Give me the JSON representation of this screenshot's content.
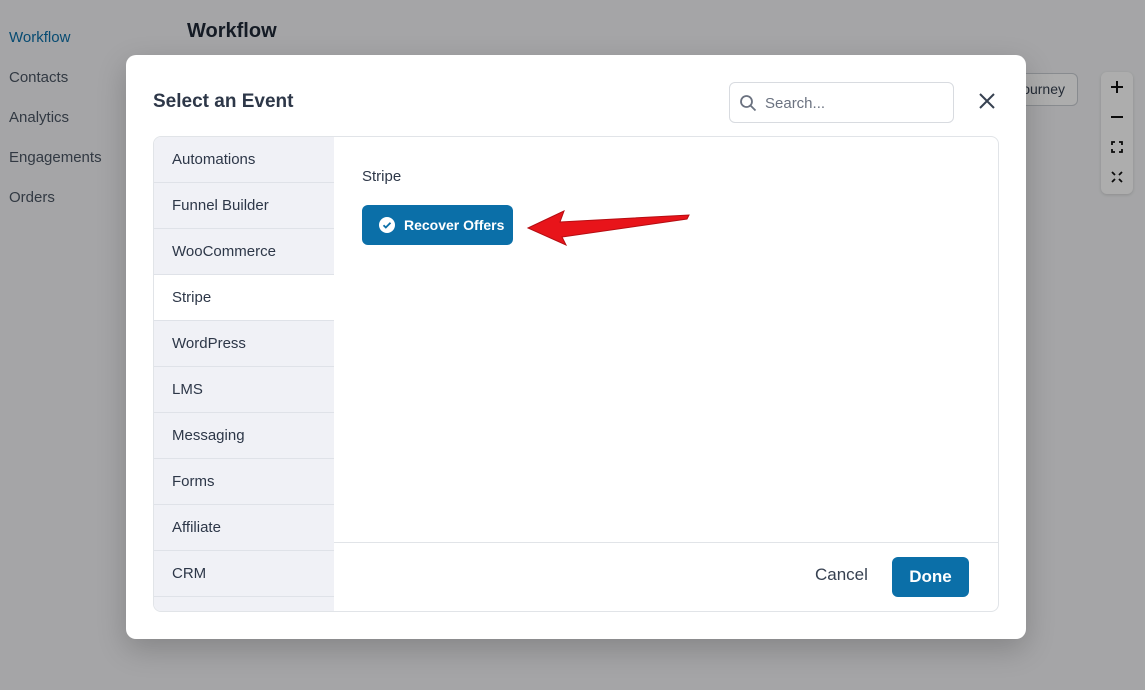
{
  "background": {
    "nav": [
      {
        "label": "Workflow"
      },
      {
        "label": "Contacts"
      },
      {
        "label": "Analytics"
      },
      {
        "label": "Engagements"
      },
      {
        "label": "Orders"
      }
    ],
    "page_title": "Workflow",
    "journey_button_label": "ourney"
  },
  "modal": {
    "title": "Select an Event",
    "search_placeholder": "Search...",
    "categories": [
      {
        "label": "Automations"
      },
      {
        "label": "Funnel Builder"
      },
      {
        "label": "WooCommerce"
      },
      {
        "label": "Stripe"
      },
      {
        "label": "WordPress"
      },
      {
        "label": "LMS"
      },
      {
        "label": "Messaging"
      },
      {
        "label": "Forms"
      },
      {
        "label": "Affiliate"
      },
      {
        "label": "CRM"
      }
    ],
    "selected_category": "Stripe",
    "section_label": "Stripe",
    "event_button_label": "Recover Offers",
    "cancel_label": "Cancel",
    "done_label": "Done"
  },
  "colors": {
    "accent": "#0b6fa8",
    "arrow": "#e8141a"
  }
}
